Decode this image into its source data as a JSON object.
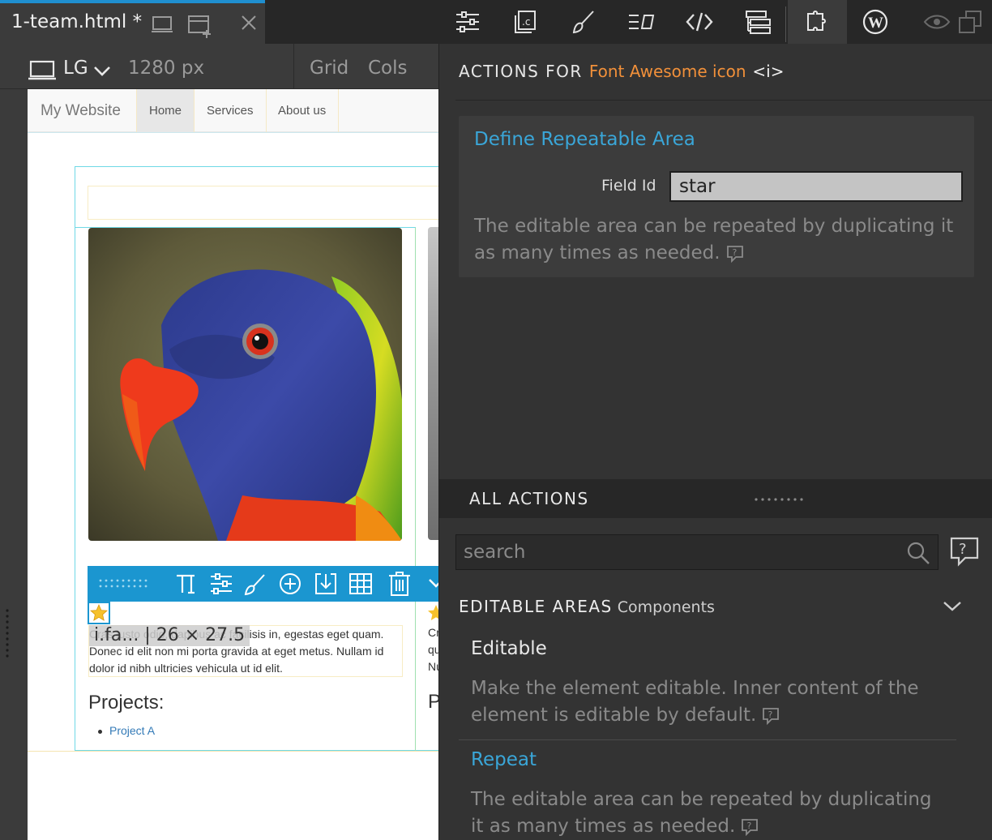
{
  "tab": {
    "title": "1-team.html *"
  },
  "device": {
    "name": "LG",
    "width": "1280 px",
    "grid": "Grid",
    "cols": "Cols"
  },
  "site": {
    "brand": "My Website",
    "nav": [
      "Home",
      "Services",
      "About us"
    ],
    "bio": "Cras justo odio, dapibus ac facilisis in, egestas eget quam. Donec id elit non mi porta gravida at eget metus. Nullam id dolor id nibh ultricies vehicula ut id elit.",
    "projects_heading": "Projects:",
    "project_item": "Project A",
    "col2_heading": "P",
    "col2_text": "Cr\nqu\nNu"
  },
  "selection": {
    "badge": "i.fa... | 26 × 27.5"
  },
  "actions_panel": {
    "heading": "ACTIONS FOR",
    "target": "Font Awesome icon",
    "tag": "<i>",
    "define": {
      "title": "Define Repeatable Area",
      "field_label": "Field Id",
      "field_value": "star",
      "description": "The editable area can be repeated by duplicating it as many times as needed."
    },
    "all_actions": "ALL ACTIONS",
    "search_placeholder": "search",
    "section": {
      "title": "EDITABLE AREAS",
      "subtitle": "Components"
    },
    "items": [
      {
        "title": "Editable",
        "description": "Make the element editable. Inner content of the element is editable by default."
      },
      {
        "title": "Repeat",
        "description": "The editable area can be repeated by duplicating it as many times as needed."
      }
    ]
  },
  "colors": {
    "accent": "#1b96d0",
    "orange": "#f1903a",
    "link": "#3aa6d8"
  },
  "icons": [
    "tablet-icon",
    "new-window-icon",
    "close-icon",
    "properties-icon",
    "css-class-icon",
    "style-icon",
    "text-format-icon",
    "code-icon",
    "tree-icon",
    "components-icon",
    "wordpress-icon",
    "eye-icon",
    "copy-icon",
    "laptop-icon",
    "chevron-down-icon",
    "search-icon",
    "help-icon",
    "star-icon"
  ]
}
